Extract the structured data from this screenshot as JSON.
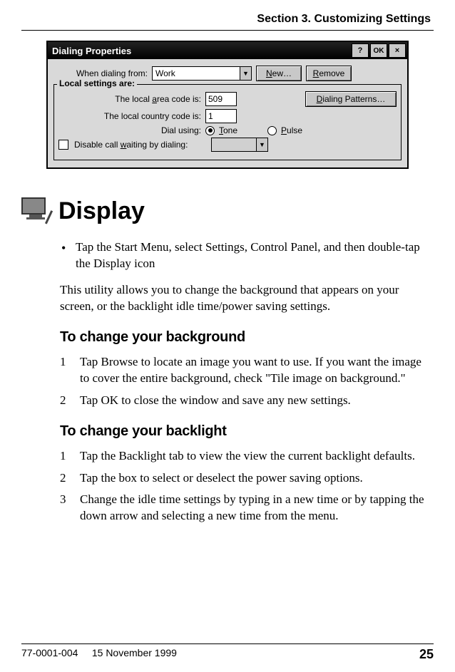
{
  "header": {
    "section_title": "Section 3. Customizing Settings"
  },
  "dialog": {
    "title": "Dialing Properties",
    "help_btn": "?",
    "ok_btn": "OK",
    "close_btn": "×",
    "when_dialing_label": "When dialing from:",
    "when_dialing_value": "Work",
    "new_btn": "New…",
    "remove_btn": "Remove",
    "fieldset_legend": "Local settings are:",
    "area_code_label": "The local area code is:",
    "area_code_value": "509",
    "dialing_patterns_btn": "Dialing Patterns…",
    "country_code_label": "The local country code is:",
    "country_code_value": "1",
    "dial_using_label": "Dial using:",
    "tone_label": "Tone",
    "pulse_label": "Pulse",
    "disable_waiting_label": "Disable call waiting by dialing:"
  },
  "main": {
    "heading": "Display",
    "bullet1": "Tap the Start Menu, select Settings, Control Panel, and then double-tap the Display icon",
    "intro": "This utility allows you to change the background that appears on your screen, or the backlight idle time/power saving settings.",
    "sub1": "To change your background",
    "bg_step1": "Tap Browse to locate an image you want to use. If you want the image to cover the entire background, check \"Tile image on background.\"",
    "bg_step2": "Tap OK to close the window and save any new settings.",
    "sub2": "To change your backlight",
    "bl_step1": "Tap the Backlight tab to view the view the current backlight defaults.",
    "bl_step2": "Tap the box to select or deselect the power saving options.",
    "bl_step3": "Change the idle time settings by typing in a new time or by tapping the down arrow and selecting a new time from the menu."
  },
  "footer": {
    "docnum": "77-0001-004",
    "date": "15 November 1999",
    "page": "25"
  }
}
